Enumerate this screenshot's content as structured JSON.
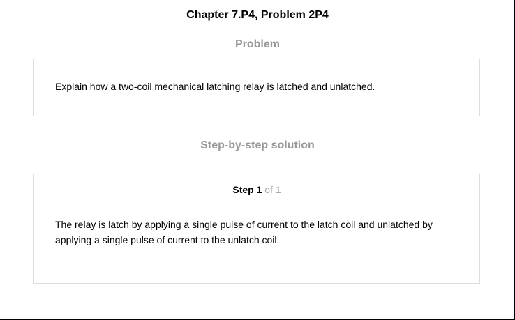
{
  "header": {
    "title": "Chapter 7.P4, Problem 2P4"
  },
  "problem": {
    "heading": "Problem",
    "text": "Explain how a two-coil mechanical latching relay is latched and unlatched."
  },
  "solution": {
    "heading": "Step-by-step solution",
    "step_word": "Step",
    "step_number": "1",
    "step_of": "of 1",
    "text": "The relay is latch by applying a single pulse of current to the latch coil and unlatched by applying a single pulse of current to the unlatch coil."
  },
  "colors": {
    "heading_gray": "#999999",
    "step_of_gray": "#aaaaaa",
    "card_border": "#dddddd"
  }
}
